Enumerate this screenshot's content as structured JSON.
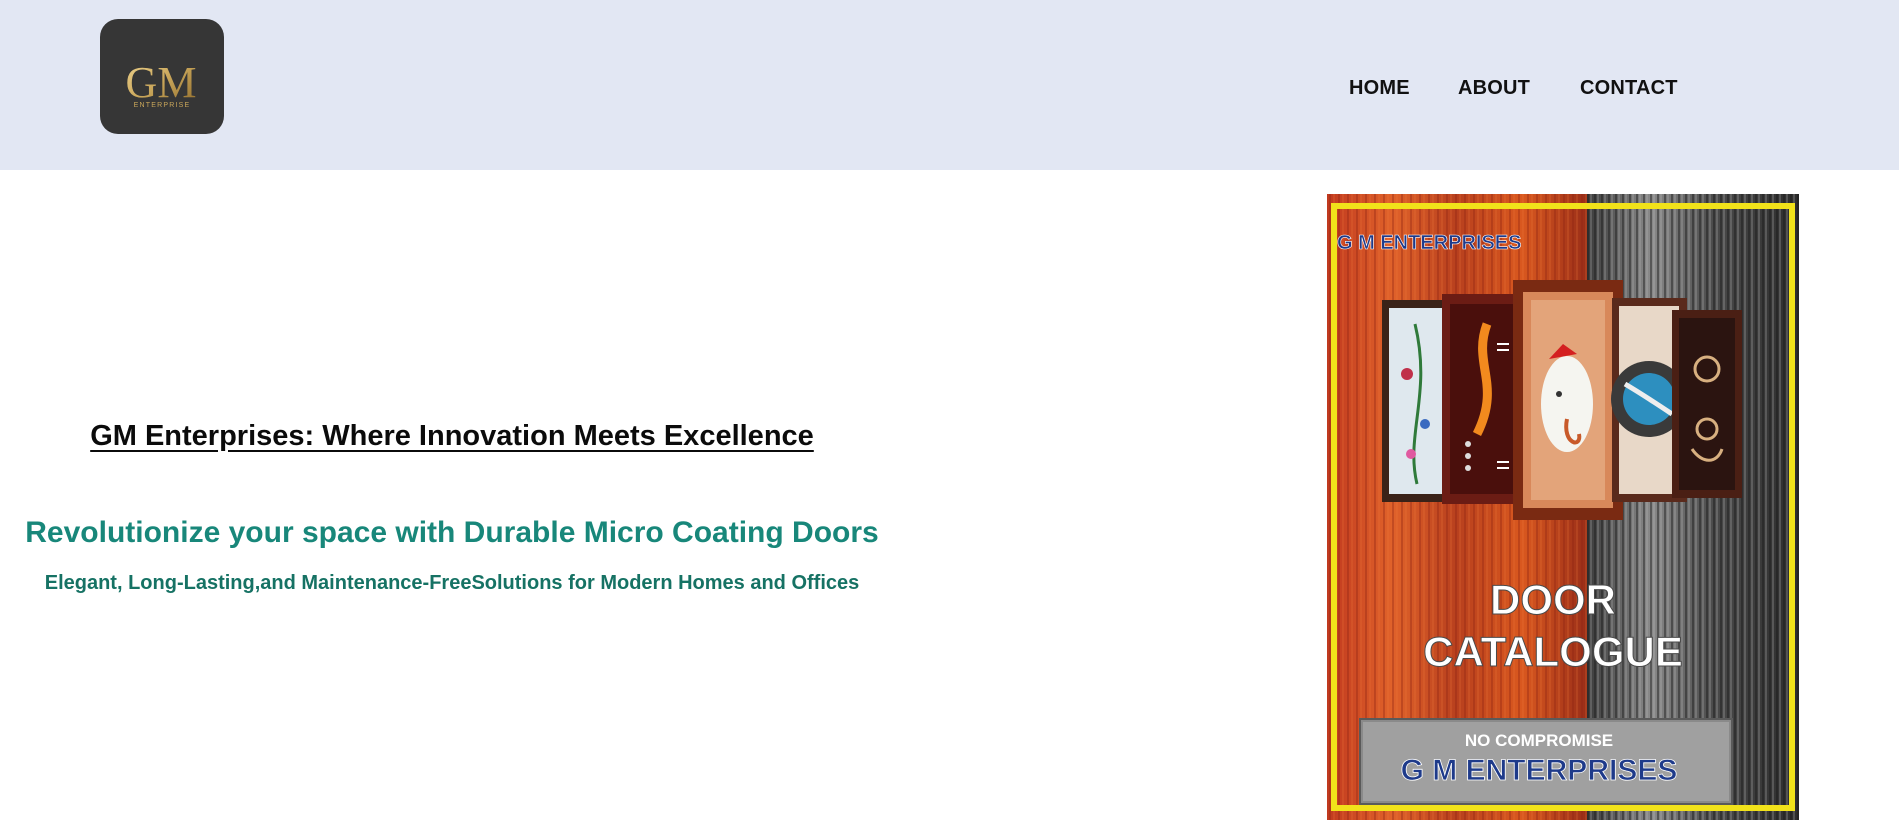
{
  "header": {
    "logo": {
      "monogram": "GM",
      "sub": "ENTERPRISE"
    },
    "nav": [
      {
        "label": "HOME"
      },
      {
        "label": "ABOUT"
      },
      {
        "label": "CONTACT"
      }
    ]
  },
  "hero": {
    "title": "GM Enterprises: Where Innovation Meets Excellence",
    "subtitle": "Revolutionize your space with Durable Micro Coating Doors",
    "tagline": "Elegant, Long-Lasting,and Maintenance-FreeSolutions for Modern Homes and Offices"
  },
  "catalogue": {
    "brand_top": "G M ENTERPRISES",
    "line1": "DOOR",
    "line2": "CATALOGUE",
    "banner_small": "NO COMPROMISE",
    "banner_big": "G M ENTERPRISES"
  },
  "colors": {
    "header_bg": "#e2e7f3",
    "accent_teal": "#18877a",
    "logo_gold": "#c9a65a",
    "catalogue_border": "#f1e21a"
  },
  "icons": {
    "logo": "gm-enterprise-logo",
    "catalogue": "door-catalogue-image"
  }
}
